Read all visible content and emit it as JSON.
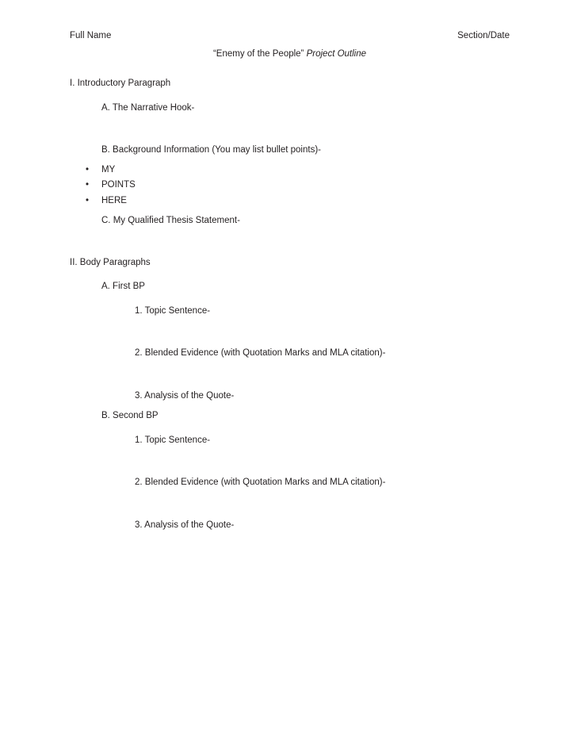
{
  "header": {
    "name": "Full Name",
    "section_date": "Section/Date"
  },
  "title": {
    "work": "“Enemy of the People”",
    "suffix": "Project Outline"
  },
  "outline": {
    "section_one": {
      "heading": "I. Introductory Paragraph",
      "item_a": "A. The Narrative Hook-",
      "item_b": "B. Background Information (You may list bullet points)-",
      "bullets": [
        {
          "marker": "•",
          "text": "MY"
        },
        {
          "marker": "•",
          "text": "POINTS"
        },
        {
          "marker": "•",
          "text": "HERE"
        }
      ],
      "item_c": "C. My Qualified Thesis Statement-"
    },
    "section_two": {
      "heading": "II. Body Paragraphs",
      "bp_one": {
        "label": "A. First BP",
        "sub_1": "1. Topic Sentence-",
        "sub_2": "2. Blended Evidence (with Quotation Marks and MLA citation)-",
        "sub_3": "3. Analysis of the Quote-"
      },
      "bp_two": {
        "label": "B. Second BP",
        "sub_1": "1. Topic Sentence-",
        "sub_2": "2. Blended Evidence (with Quotation Marks and MLA citation)-",
        "sub_3": "3. Analysis of the Quote-"
      }
    }
  }
}
